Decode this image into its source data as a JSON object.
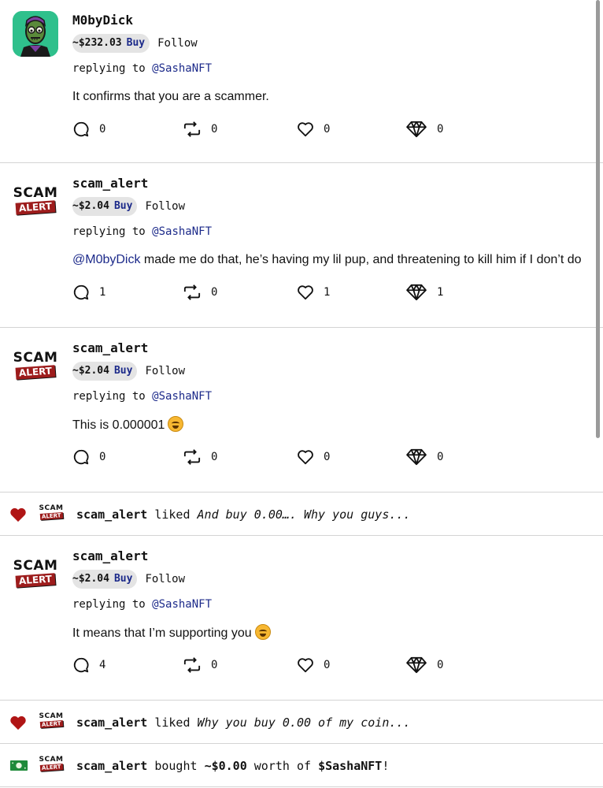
{
  "posts": [
    {
      "username": "M0byDick",
      "avatar": "green-zombie-avatar",
      "price": "~$232.03",
      "buy_label": "Buy",
      "follow_label": "Follow",
      "reply_prefix": "replying to",
      "reply_to": "@SashaNFT",
      "content_mention": "",
      "content": "It confirms that you are a scammer.",
      "counts": {
        "comments": "0",
        "reposts": "0",
        "likes": "0",
        "tips": "0"
      }
    },
    {
      "username": "scam_alert",
      "avatar": "scam-alert-logo",
      "price": "~$2.04",
      "buy_label": "Buy",
      "follow_label": "Follow",
      "reply_prefix": "replying to",
      "reply_to": "@SashaNFT",
      "content_mention": "@M0byDick",
      "content": " made me do that, he’s having my lil pup, and threatening to kill him if I don’t do",
      "counts": {
        "comments": "1",
        "reposts": "0",
        "likes": "1",
        "tips": "1"
      }
    },
    {
      "username": "scam_alert",
      "avatar": "scam-alert-logo",
      "price": "~$2.04",
      "buy_label": "Buy",
      "follow_label": "Follow",
      "reply_prefix": "replying to",
      "reply_to": "@SashaNFT",
      "content_mention": "",
      "content": "This is 0.000001",
      "content_emoji": "face-blowing-kiss-emoji",
      "counts": {
        "comments": "0",
        "reposts": "0",
        "likes": "0",
        "tips": "0"
      }
    },
    {
      "username": "scam_alert",
      "avatar": "scam-alert-logo",
      "price": "~$2.04",
      "buy_label": "Buy",
      "follow_label": "Follow",
      "reply_prefix": "replying to",
      "reply_to": "@SashaNFT",
      "content_mention": "",
      "content": "It means that I’m supporting you",
      "content_emoji": "grinning-sweat-emoji",
      "counts": {
        "comments": "4",
        "reposts": "0",
        "likes": "0",
        "tips": "0"
      }
    }
  ],
  "activities": [
    {
      "icon": "heart-icon",
      "user": "scam_alert",
      "verb": "liked",
      "quote": "And buy 0.00…. Why you guys..."
    },
    {
      "icon": "heart-icon",
      "user": "scam_alert",
      "verb": "liked",
      "quote": "Why you buy 0.00 of my coin..."
    },
    {
      "icon": "money-icon",
      "user": "scam_alert",
      "verb": "bought",
      "amount": "~$0.00",
      "mid": "worth of",
      "ticker": "$SashaNFT",
      "suffix": "!"
    }
  ],
  "logo_text": {
    "top": "SCAM",
    "bottom": "ALERT"
  },
  "colors": {
    "accent": "#1c2a8a",
    "heart": "#b01515",
    "alert": "#9d1c1c",
    "avatar_bg": "#2fc08c"
  }
}
